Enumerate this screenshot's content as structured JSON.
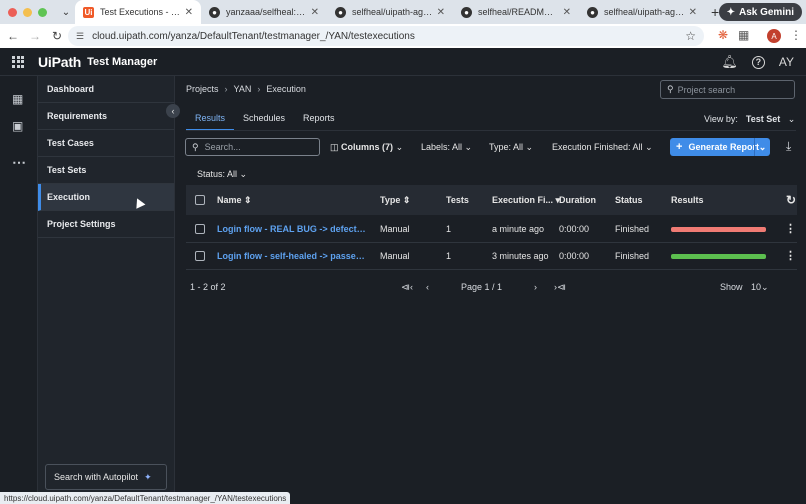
{
  "browser": {
    "tabs": [
      {
        "title": "Test Executions - Test Manager",
        "favicon": "uipath-favicon",
        "active": true
      },
      {
        "title": "yanzaaa/selfheal: new commit",
        "favicon": "github-icon",
        "active": false
      },
      {
        "title": "selfheal/uipath-agent at main",
        "favicon": "github-icon",
        "active": false
      },
      {
        "title": "selfheal/README.md at main",
        "favicon": "github-icon",
        "active": false
      },
      {
        "title": "selfheal/uipath-agent/main",
        "favicon": "github-icon",
        "active": false
      }
    ],
    "ask_gemini": "Ask Gemini",
    "url": "cloud.uipath.com/yanza/DefaultTenant/testmanager_/YAN/testexecutions",
    "profile_initial": "A",
    "status_url": "https://cloud.uipath.com/yanza/DefaultTenant/testmanager_/YAN/testexecutions"
  },
  "app": {
    "brand": "UiPath",
    "product": "Test Manager",
    "user_initials": "AY"
  },
  "sidebar": {
    "items": [
      {
        "label": "Dashboard",
        "active": false
      },
      {
        "label": "Requirements",
        "active": false
      },
      {
        "label": "Test Cases",
        "active": false
      },
      {
        "label": "Test Sets",
        "active": false
      },
      {
        "label": "Execution",
        "active": true
      },
      {
        "label": "Project Settings",
        "active": false
      }
    ],
    "autopilot": "Search with Autopilot"
  },
  "breadcrumb": [
    "Projects",
    "YAN",
    "Execution"
  ],
  "project_search_placeholder": "Project search",
  "subtabs": [
    "Results",
    "Schedules",
    "Reports"
  ],
  "view_by": {
    "label": "View by:",
    "value": "Test Set"
  },
  "filters": {
    "search_placeholder": "Search...",
    "columns": "Columns (7)",
    "labels": "Labels: All",
    "type": "Type: All",
    "execution_finished": "Execution Finished: All",
    "status": "Status: All"
  },
  "generate_report": "Generate Report",
  "table": {
    "headers": [
      "Name",
      "Type",
      "Tests",
      "Execution Fi...",
      "Duration",
      "Status",
      "Results"
    ],
    "rows": [
      {
        "name": "Login flow - REAL BUG -> defect filed (...",
        "type": "Manual",
        "tests": "1",
        "executed": "a minute ago",
        "duration": "0:00:00",
        "status": "Finished",
        "result_color": "#f07b74"
      },
      {
        "name": "Login flow - self-healed -> passed (Sel...",
        "type": "Manual",
        "tests": "1",
        "executed": "3 minutes ago",
        "duration": "0:00:00",
        "status": "Finished",
        "result_color": "#5cbf4f"
      }
    ]
  },
  "pager": {
    "range": "1 - 2 of 2",
    "page": "Page 1 / 1",
    "show_label": "Show",
    "page_size": "10"
  }
}
